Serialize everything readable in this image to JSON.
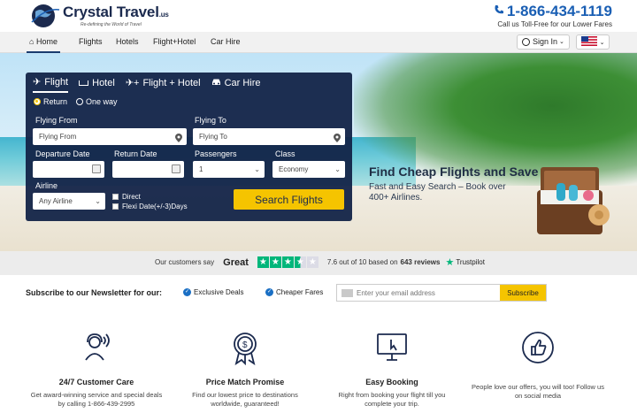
{
  "header": {
    "logo_title": "Crystal Travel",
    "logo_suffix": ".us",
    "logo_tagline": "Re-defining the World of Travel",
    "phone": "1-866-434-1119",
    "phone_sub": "Call us Toll-Free for our Lower Fares"
  },
  "nav": {
    "items": [
      {
        "label": "Home"
      },
      {
        "label": "Flights"
      },
      {
        "label": "Hotels"
      },
      {
        "label": "Flight+Hotel"
      },
      {
        "label": "Car Hire"
      }
    ],
    "signin": "Sign In"
  },
  "search": {
    "tabs": [
      {
        "label": "Flight",
        "icon": "plane-icon"
      },
      {
        "label": "Hotel",
        "icon": "bed-icon"
      },
      {
        "label": "Flight + Hotel",
        "icon": "plane-bed-icon"
      },
      {
        "label": "Car Hire",
        "icon": "car-icon"
      }
    ],
    "trip_types": [
      "Return",
      "One way"
    ],
    "flying_from_label": "Flying From",
    "flying_from_placeholder": "Flying From",
    "flying_to_label": "Flying To",
    "flying_to_placeholder": "Flying To",
    "departure_label": "Departure Date",
    "return_label": "Return Date",
    "passengers_label": "Passengers",
    "passengers_value": "1",
    "class_label": "Class",
    "class_value": "Economy",
    "airline_label": "Airline",
    "airline_value": "Any Airline",
    "direct_label": "Direct",
    "flexi_label": "Flexi Date(+/-3)Days",
    "button": "Search Flights"
  },
  "promo": {
    "title": "Find Cheap Flights and Save",
    "subtitle": "Fast and Easy Search – Book over 400+ Airlines."
  },
  "trust": {
    "prefix": "Our customers say",
    "rating_word": "Great",
    "score_text": "7.6 out of 10 based on",
    "reviews_count": "643 reviews",
    "brand": "Trustpilot",
    "stars": 3.5
  },
  "newsletter": {
    "title": "Subscribe to our Newsletter for our:",
    "perks": [
      "Exclusive Deals",
      "Cheaper Fares"
    ],
    "email_placeholder": "Enter your email address",
    "button": "Subscribe"
  },
  "features": [
    {
      "title": "24/7 Customer Care",
      "desc": "Get award-winning service and special deals by calling 1-866-439-2995",
      "icon": "headset-icon"
    },
    {
      "title": "Price Match Promise",
      "desc": "Find our lowest price to destinations worldwide, guaranteed!",
      "icon": "price-badge-icon"
    },
    {
      "title": "Easy Booking",
      "desc": "Right from booking your flight till you complete your trip.",
      "icon": "computer-click-icon"
    },
    {
      "title": "",
      "desc": "People love our offers, you will too! Follow us on social media",
      "icon": "thumbs-up-icon"
    }
  ],
  "colors": {
    "brand_navy": "#112246",
    "accent_yellow": "#f5c400",
    "phone_blue": "#1a5fb4",
    "trustpilot_green": "#00b67a"
  }
}
